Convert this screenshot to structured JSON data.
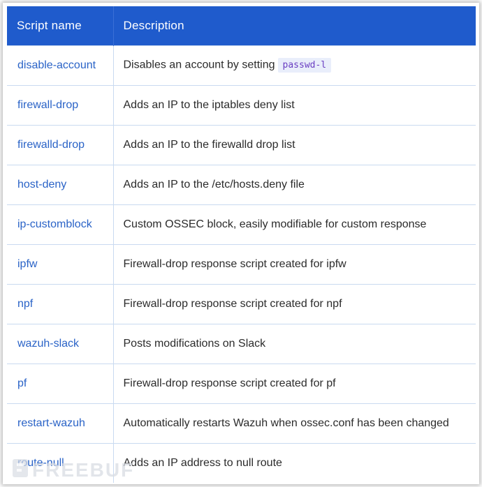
{
  "table": {
    "headers": [
      "Script name",
      "Description"
    ],
    "rows": [
      {
        "name": "disable-account",
        "desc": "Disables an account by setting",
        "code": "passwd-l"
      },
      {
        "name": "firewall-drop",
        "desc": "Adds an IP to the iptables deny list"
      },
      {
        "name": "firewalld-drop",
        "desc": "Adds an IP to the firewalld drop list"
      },
      {
        "name": "host-deny",
        "desc": "Adds an IP to the /etc/hosts.deny file"
      },
      {
        "name": "ip-customblock",
        "desc": "Custom OSSEC block, easily modifiable for custom response"
      },
      {
        "name": "ipfw",
        "desc": "Firewall-drop response script created for ipfw"
      },
      {
        "name": "npf",
        "desc": "Firewall-drop response script created for npf"
      },
      {
        "name": "wazuh-slack",
        "desc": "Posts modifications on Slack"
      },
      {
        "name": "pf",
        "desc": "Firewall-drop response script created for pf"
      },
      {
        "name": "restart-wazuh",
        "desc": "Automatically restarts Wazuh when ossec.conf has been changed"
      },
      {
        "name": "route-null",
        "desc": "Adds an IP address to null route"
      }
    ]
  },
  "watermark": "FREEBUF",
  "colors": {
    "header_bg": "#1f5bcc",
    "link": "#2a63c7",
    "divider": "#c9daf0"
  }
}
